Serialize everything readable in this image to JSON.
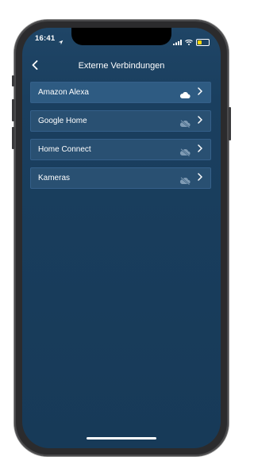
{
  "status": {
    "time": "16:41",
    "battery_color": "#ffd60a"
  },
  "nav": {
    "back_icon": "chevron-left-icon",
    "title": "Externe Verbindungen"
  },
  "connections": [
    {
      "label": "Amazon Alexa",
      "status_icon": "cloud-icon"
    },
    {
      "label": "Google Home",
      "status_icon": "cloud-off-icon"
    },
    {
      "label": "Home Connect",
      "status_icon": "cloud-off-icon"
    },
    {
      "label": "Kameras",
      "status_icon": "cloud-off-icon"
    }
  ],
  "colors": {
    "background": "#1a3f5f",
    "row": "#295072",
    "row_border": "#35608a",
    "text": "#ffffff",
    "icon_muted": "#7f9bb4"
  }
}
